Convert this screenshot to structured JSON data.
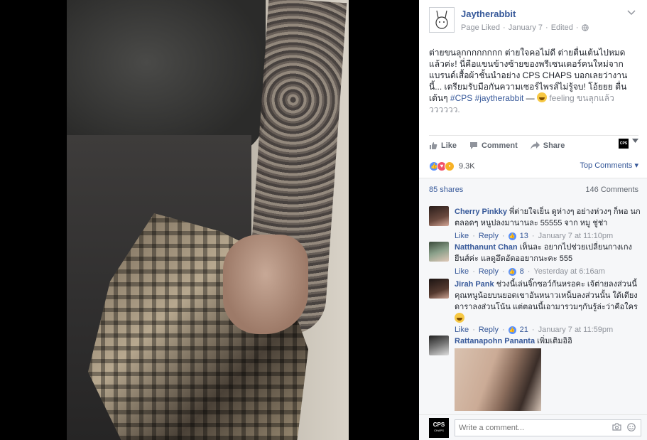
{
  "post": {
    "page_name": "Jaytherabbit",
    "page_liked": "Page Liked",
    "date": "January 7",
    "edited": "Edited",
    "separator": "·",
    "text_main": "ต่ายขนลุกกกกกกกก ต่ายใจคอไม่ดี ต่ายตื่นเต้นไปหมดแล้วค่ะ! นี่คือแขนข้างซ้ายของพรีเซนเตอร์คนใหม่จากแบรนด์เสื้อผ้าชั้นนำอย่าง CPS CHAPS บอกเลยว่างานนี้... เตรียมรับมือกันความเซอร์ไพรส์ไม่รู้จบ! โอ้ยยย ตื่นเต้นๆ",
    "hashtag_cps": "#CPS",
    "hashtag_jay": "#jaytherabbit",
    "dash": "—",
    "feeling": "feeling ขนลุกแล้ววววววว."
  },
  "actions": {
    "like": "Like",
    "comment": "Comment",
    "share": "Share",
    "cps_label": "CPS"
  },
  "stats": {
    "reaction_count": "9.3K",
    "top_comments": "Top Comments",
    "shares": "85 shares",
    "comments": "146 Comments"
  },
  "comments": [
    {
      "name": "Cherry Pinkky",
      "text": "พี่ต่ายใจเย็น ดูห่างๆ อย่างห่วงๆ ก็พอ นกตลอดๆ หนูปลงมานานละ 55555 จาก หมู ชู่ช่า",
      "like": "Like",
      "reply": "Reply",
      "likes": "13",
      "time": "January 7 at 11:10pm"
    },
    {
      "name": "Natthanunt Chan",
      "text": "เห็นละ อยากไปช่วยเปลี่ยนกางเกงยีนส์ค่ะ แลดูอึดอัดออยากนะคะ 555",
      "like": "Like",
      "reply": "Reply",
      "likes": "8",
      "time": "Yesterday at 6:16am"
    },
    {
      "name": "Jirah Pank",
      "text": "ช่วงนี้เล่นจิ๊กซอว์กันหรอคะ เจ้ต่ายลงส่วนนี้ คุณหนูน้อยบนยอดเขาอันหนาวเหน็บลงส่วนนั้น ใต้เตียงดาราลงส่วนโน้น แต่ตอนนี้เอามารวมๆกันรู้ล่ะว่าคือใคร",
      "like": "Like",
      "reply": "Reply",
      "likes": "21",
      "time": "January 7 at 11:59pm"
    },
    {
      "name": "Rattanapohn Pananta",
      "text": "เพิ่มเติมอิอิ"
    }
  ],
  "composer": {
    "placeholder": "Write a comment...",
    "avatar_label": "CPS",
    "avatar_sub": "CHAPS"
  },
  "icons": [
    "thumbs-up-icon",
    "comment-icon",
    "share-icon",
    "chevron-down-icon",
    "globe-icon",
    "camera-icon",
    "smiley-icon"
  ],
  "colors": {
    "link": "#365899",
    "meta": "#90949c",
    "like": "#5890ff",
    "love": "#f25268",
    "wow": "#f7b125"
  }
}
